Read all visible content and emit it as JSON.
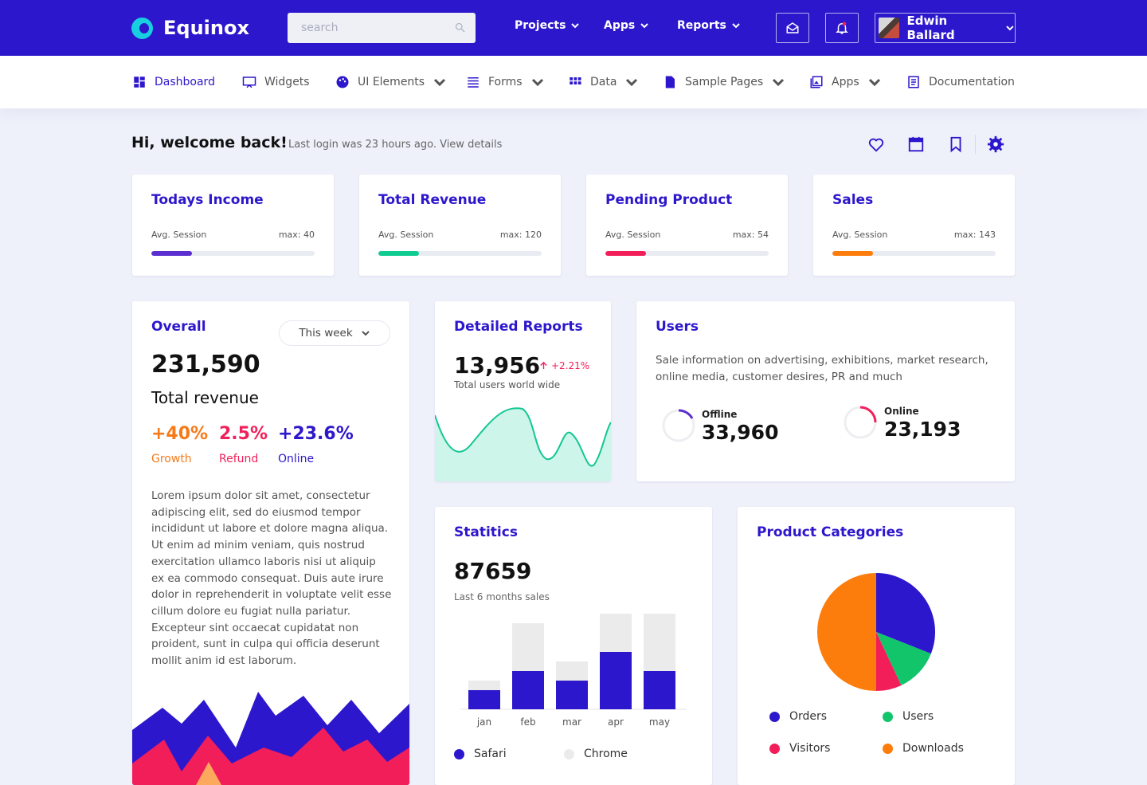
{
  "brand": "Equinox",
  "search": {
    "placeholder": "search"
  },
  "topnav": [
    "Projects",
    "Apps",
    "Reports"
  ],
  "user": {
    "name": "Edwin Ballard"
  },
  "subnav": [
    "Dashboard",
    "Widgets",
    "UI Elements",
    "Forms",
    "Data",
    "Sample Pages",
    "Apps",
    "Documentation"
  ],
  "welcome": {
    "title": "Hi, welcome back!",
    "subtitle": "Last login was 23 hours ago. View details"
  },
  "stats": [
    {
      "title": "Todays Income",
      "label": "Avg. Session",
      "max": "max: 40",
      "progress": 0.25,
      "color": "#5b2fcf"
    },
    {
      "title": "Total Revenue",
      "label": "Avg. Session",
      "max": "max: 120",
      "progress": 0.25,
      "color": "#10cc91"
    },
    {
      "title": "Pending Product",
      "label": "Avg. Session",
      "max": "max: 54",
      "progress": 0.25,
      "color": "#f21e5a"
    },
    {
      "title": "Sales",
      "label": "Avg. Session",
      "max": "max: 143",
      "progress": 0.25,
      "color": "#fc7d0b"
    }
  ],
  "overall": {
    "title": "Overall",
    "period": "This week",
    "value": "231,590",
    "label": "Total revenue",
    "metrics": [
      {
        "value": "+40%",
        "label": "Growth",
        "color": "#f77a18"
      },
      {
        "value": "2.5%",
        "label": "Refund",
        "color": "#f0205a"
      },
      {
        "value": "+23.6%",
        "label": "Online",
        "color": "#2d17cc"
      }
    ],
    "text": "Lorem ipsum dolor sit amet, consectetur adipiscing elit, sed do eiusmod tempor incididunt ut labore et dolore magna aliqua. Ut enim ad minim veniam, quis nostrud exercitation ullamco laboris nisi ut aliquip ex ea commodo consequat. Duis aute irure dolor in reprehenderit in voluptate velit esse cillum dolore eu fugiat nulla pariatur. Excepteur sint occaecat cupidatat non proident, sunt in culpa qui officia deserunt mollit anim id est laborum."
  },
  "detailed": {
    "title": "Detailed Reports",
    "value": "13,956",
    "change": "+2.21%",
    "caption": "Total users world wide"
  },
  "users": {
    "title": "Users",
    "description": "Sale information on advertising, exhibitions, market research, online media, customer desires, PR and much",
    "offline": {
      "label": "Offline",
      "value": "33,960",
      "color": "#5b2fcf"
    },
    "online": {
      "label": "Online",
      "value": "23,193",
      "color": "#f21e5a"
    }
  },
  "statistics": {
    "title": "Statitics",
    "value": "87659",
    "caption": "Last 6 months sales",
    "legend": [
      "Safari",
      "Chrome"
    ],
    "chart_data": {
      "type": "bar",
      "categories": [
        "jan",
        "feb",
        "mar",
        "apr",
        "may"
      ],
      "series": [
        {
          "name": "Safari",
          "values": [
            20,
            40,
            30,
            60,
            40
          ],
          "color": "#2d17cc"
        },
        {
          "name": "Chrome",
          "values": [
            10,
            50,
            20,
            40,
            60
          ],
          "color": "#ebebeb"
        }
      ],
      "stacked": true
    }
  },
  "categories": {
    "title": "Product Categories",
    "chart_data": {
      "type": "pie",
      "labels": [
        "Orders",
        "Users",
        "Visitors",
        "Downloads"
      ],
      "values": [
        31,
        12,
        7,
        50
      ],
      "colors": [
        "#2d17cc",
        "#12c56b",
        "#f21e5a",
        "#fc7d0b"
      ]
    }
  }
}
